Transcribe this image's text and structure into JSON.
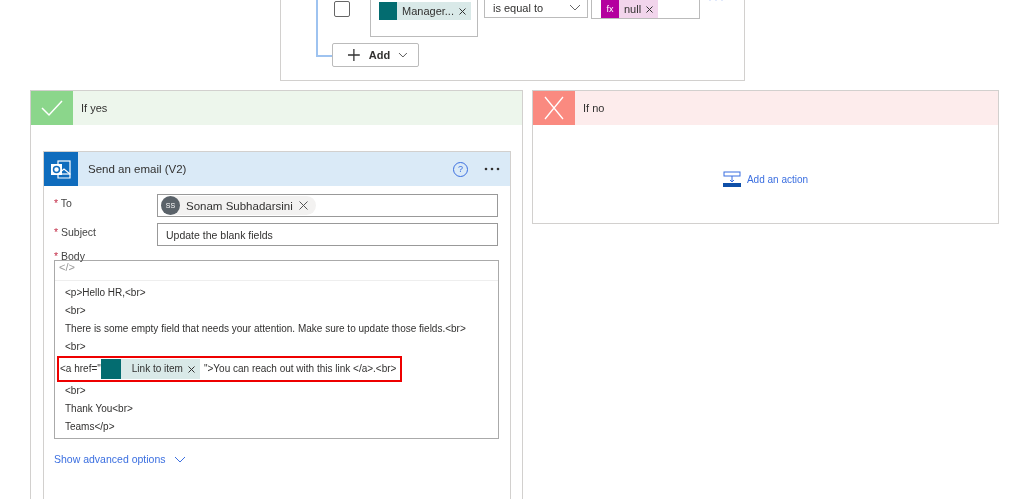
{
  "condition": {
    "checked": false,
    "left_token": "Manager...",
    "operator": "is equal to",
    "fx_label": "fx",
    "right_token": "null",
    "add_button": "Add"
  },
  "yes_branch": {
    "title": "If yes",
    "action": {
      "title": "Send an email (V2)",
      "help_label": "?",
      "code_view_label": "</>",
      "fields": [
        {
          "label": "To",
          "required_mark": "*",
          "kind": "people",
          "value": "Sonam Subhadarsini",
          "initials": "SS"
        },
        {
          "label": "Subject",
          "required_mark": "*",
          "kind": "text",
          "value": "Update the blank fields"
        }
      ],
      "body": {
        "label": "Body",
        "required_mark": "*",
        "lines": [
          {
            "kind": "text",
            "text": "<p>Hello HR,<br>"
          },
          {
            "kind": "text",
            "text": "<br>"
          },
          {
            "kind": "text",
            "text": "There is some empty field that needs your attention. Make sure to update those fields.<br>"
          },
          {
            "kind": "text",
            "text": "<br>"
          },
          {
            "kind": "token",
            "prefix": "<a href=\"",
            "token": "Link to item",
            "suffix": "\">You can reach out with this link </a>.<br>",
            "highlighted": true
          },
          {
            "kind": "text",
            "text": "<br>"
          },
          {
            "kind": "text",
            "text": "Thank You<br>"
          },
          {
            "kind": "text",
            "text": "Teams</p>"
          }
        ]
      },
      "advanced_link": "Show advanced options"
    }
  },
  "no_branch": {
    "title": "If no",
    "add_action": "Add an action"
  }
}
